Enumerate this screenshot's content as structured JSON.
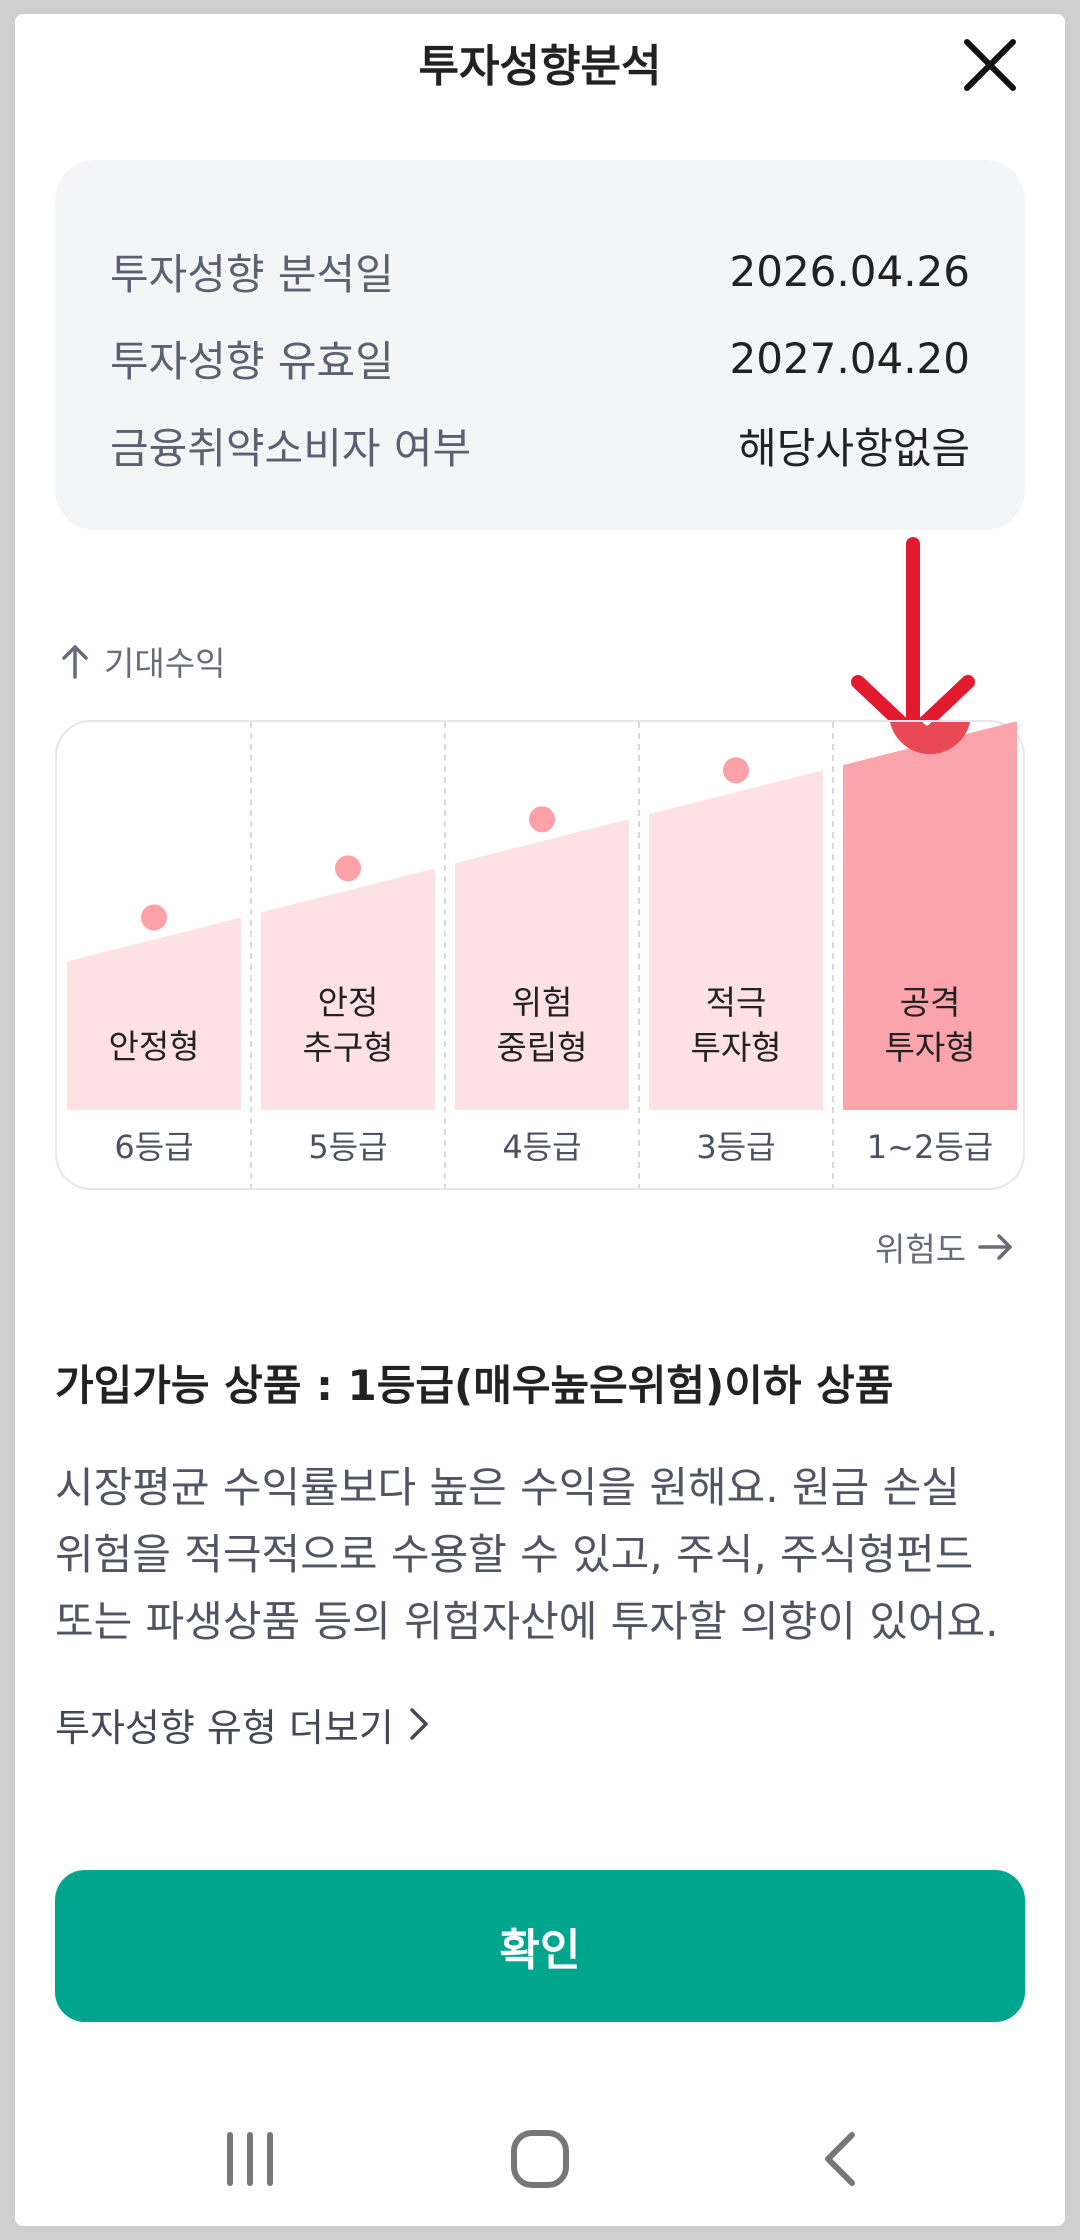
{
  "header": {
    "title": "투자성향분석",
    "close_icon": "close-icon"
  },
  "info": {
    "rows": [
      {
        "label": "투자성향 분석일",
        "value": "2026.04.26"
      },
      {
        "label": "투자성향 유효일",
        "value": "2027.04.20"
      },
      {
        "label": "금융취약소비자 여부",
        "value": "해당사항없음"
      }
    ]
  },
  "chart": {
    "y_axis_label": "기대수익",
    "x_axis_label": "위험도",
    "columns": [
      {
        "line1": "안정형",
        "line2": "",
        "grade": "6등급"
      },
      {
        "line1": "안정",
        "line2": "추구형",
        "grade": "5등급"
      },
      {
        "line1": "위험",
        "line2": "중립형",
        "grade": "4등급"
      },
      {
        "line1": "적극",
        "line2": "투자형",
        "grade": "3등급"
      },
      {
        "line1": "공격",
        "line2": "투자형",
        "grade": "1~2등급"
      }
    ],
    "selected_index": 4,
    "colors": {
      "bar": "#fde1e3",
      "bar_selected": "#fca4ab",
      "dot": "#fca1a8",
      "check_badge": "#e84955",
      "arrow": "#e3192e"
    }
  },
  "products": {
    "title": "가입가능 상품 : 1등급(매우높은위험)이하 상품",
    "description_lines": [
      "시장평균 수익률보다 높은 수익을 원해요. 원금 손실",
      "위험을 적극적으로 수용할 수 있고, 주식, 주식형펀드",
      "또는 파생상품 등의 위험자산에 투자할 의향이 있어요."
    ],
    "more_link": "투자성향 유형 더보기"
  },
  "confirm_label": "확인",
  "accent_color": "#00a58e"
}
